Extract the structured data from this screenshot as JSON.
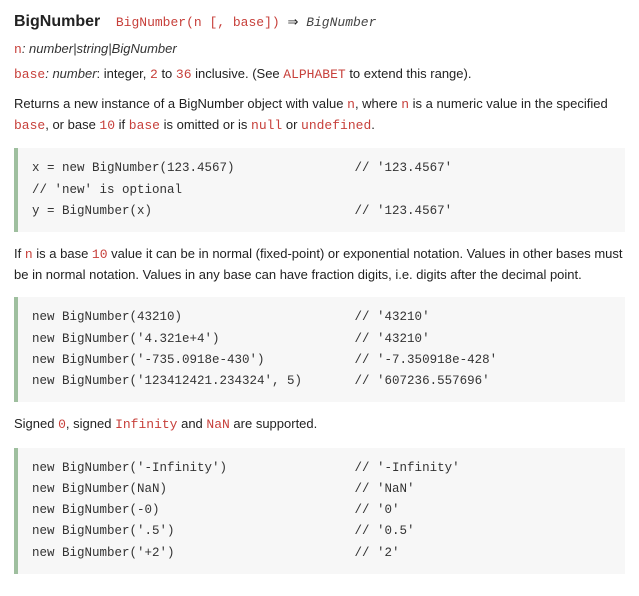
{
  "header": {
    "title": "BigNumber",
    "signature_call": "BigNumber(n [, base])",
    "arrow": " ⇒ ",
    "signature_ret": "BigNumber"
  },
  "params": {
    "n_name": "n",
    "n_type": ": number|string|BigNumber",
    "base_name": "base",
    "base_type_pre": ": number",
    "base_desc_pre": ": integer, ",
    "base_lo": "2",
    "base_mid": " to ",
    "base_hi": "36",
    "base_desc_post": " inclusive. (See ",
    "alphabet": "ALPHABET",
    "base_desc_end": " to extend this range)."
  },
  "desc1": {
    "a": "Returns a new instance of a BigNumber object with value ",
    "n": "n",
    "b": ", where ",
    "n2": "n",
    "c": " is a numeric value in the specified ",
    "base": "base",
    "d": ", or base ",
    "ten": "10",
    "e": " if ",
    "base2": "base",
    "f": " is omitted or is ",
    "null": "null",
    "g": " or ",
    "undef": "undefined",
    "h": "."
  },
  "code1": "x = new BigNumber(123.4567)                // '123.4567'\n// 'new' is optional\ny = BigNumber(x)                           // '123.4567'",
  "desc2": {
    "a": "If ",
    "n": "n",
    "b": " is a base ",
    "ten": "10",
    "c": " value it can be in normal (fixed-point) or exponential notation. Values in other bases must be in normal notation. Values in any base can have fraction digits, i.e. digits after the decimal point."
  },
  "code2": "new BigNumber(43210)                       // '43210'\nnew BigNumber('4.321e+4')                  // '43210'\nnew BigNumber('-735.0918e-430')            // '-7.350918e-428'\nnew BigNumber('123412421.234324', 5)       // '607236.557696'",
  "desc3": {
    "a": "Signed ",
    "zero": "0",
    "b": ", signed ",
    "inf": "Infinity",
    "c": " and ",
    "nan": "NaN",
    "d": " are supported."
  },
  "code3": "new BigNumber('-Infinity')                 // '-Infinity'\nnew BigNumber(NaN)                         // 'NaN'\nnew BigNumber(-0)                          // '0'\nnew BigNumber('.5')                        // '0.5'\nnew BigNumber('+2')                        // '2'"
}
